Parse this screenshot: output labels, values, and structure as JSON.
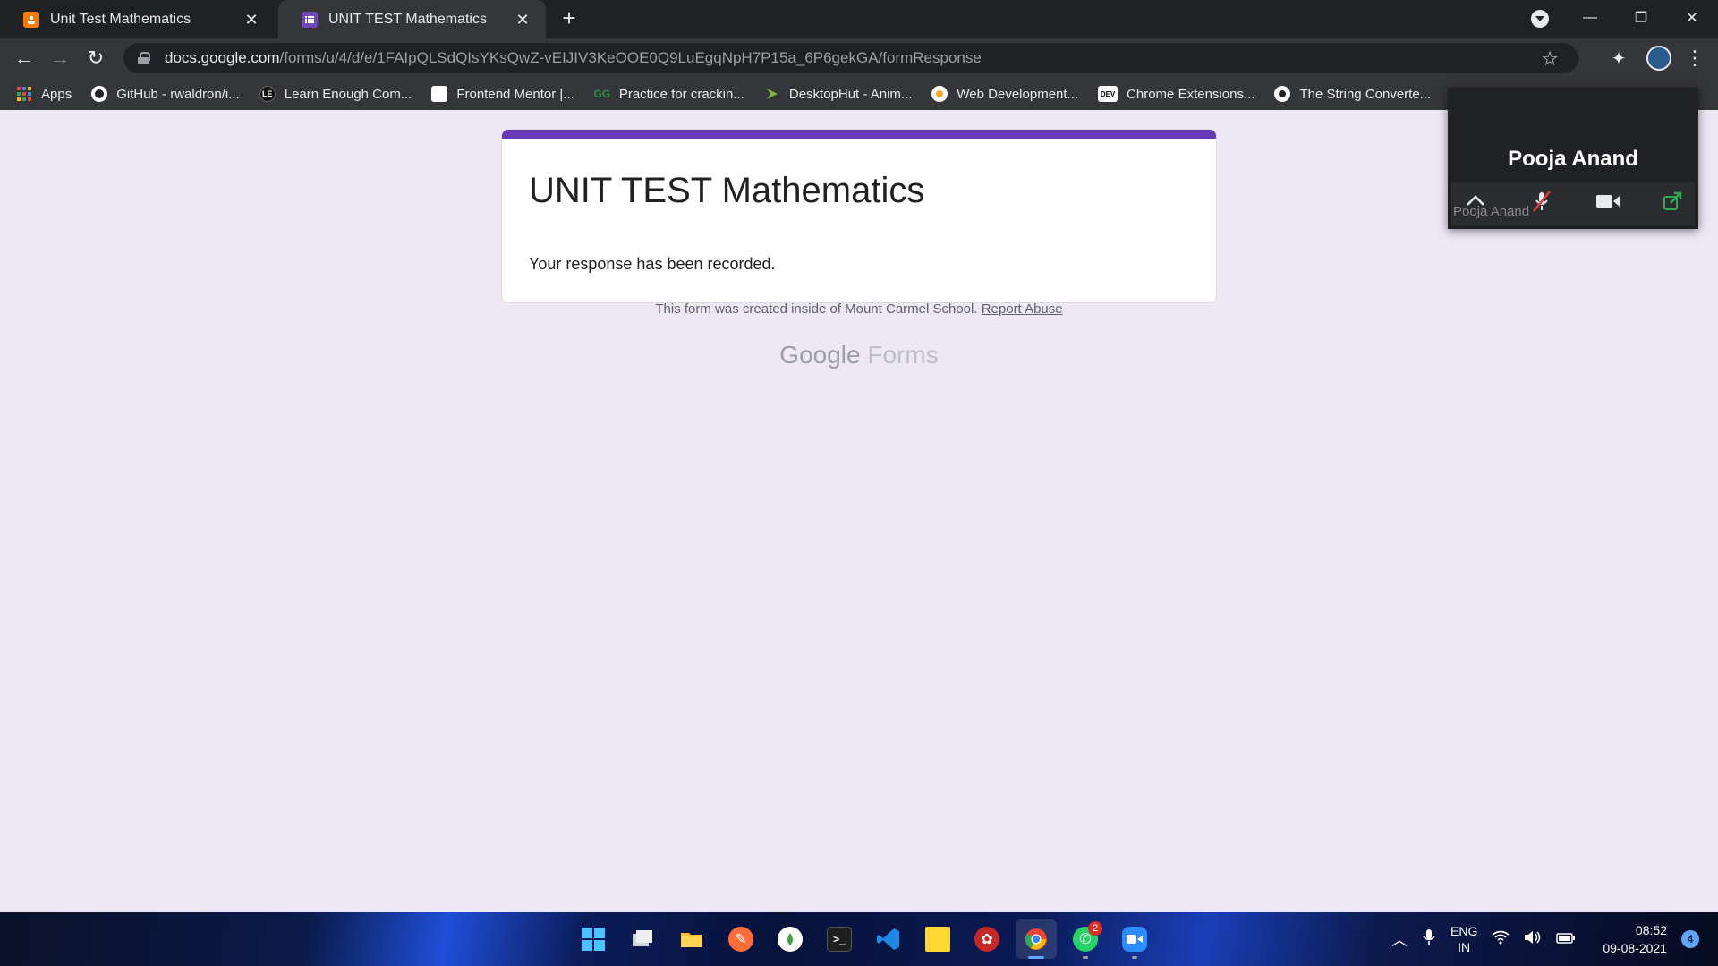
{
  "browser": {
    "tabs": [
      {
        "title": "Unit Test Mathematics",
        "active": false
      },
      {
        "title": "UNIT TEST Mathematics",
        "active": true
      }
    ],
    "url_host": "docs.google.com",
    "url_path": "/forms/u/4/d/e/1FAIpQLSdQIsYKsQwZ-vEIJIV3KeOOE0Q9LuEgqNpH7P15a_6P6gekGA/formResponse"
  },
  "bookmarks": [
    {
      "label": "Apps"
    },
    {
      "label": "GitHub - rwaldron/i..."
    },
    {
      "label": "Learn Enough Com..."
    },
    {
      "label": "Frontend Mentor |..."
    },
    {
      "label": "Practice for crackin..."
    },
    {
      "label": "DesktopHut - Anim..."
    },
    {
      "label": "Web Development..."
    },
    {
      "label": "Chrome Extensions..."
    },
    {
      "label": "The String Converte..."
    }
  ],
  "form": {
    "title": "UNIT TEST Mathematics",
    "confirmation": "Your response has been recorded.",
    "footer_text": "This form was created inside of Mount Carmel School.",
    "report_link": "Report Abuse",
    "brand_google": "Google",
    "brand_forms": "Forms",
    "accent_color": "#673ab7"
  },
  "meeting": {
    "participant_name": "Pooja Anand",
    "participant_sub": "Pooja Anand"
  },
  "taskbar": {
    "lang_top": "ENG",
    "lang_bottom": "IN",
    "time": "08:52",
    "date": "09-08-2021",
    "whatsapp_badge": "2",
    "notification_count": "4"
  }
}
